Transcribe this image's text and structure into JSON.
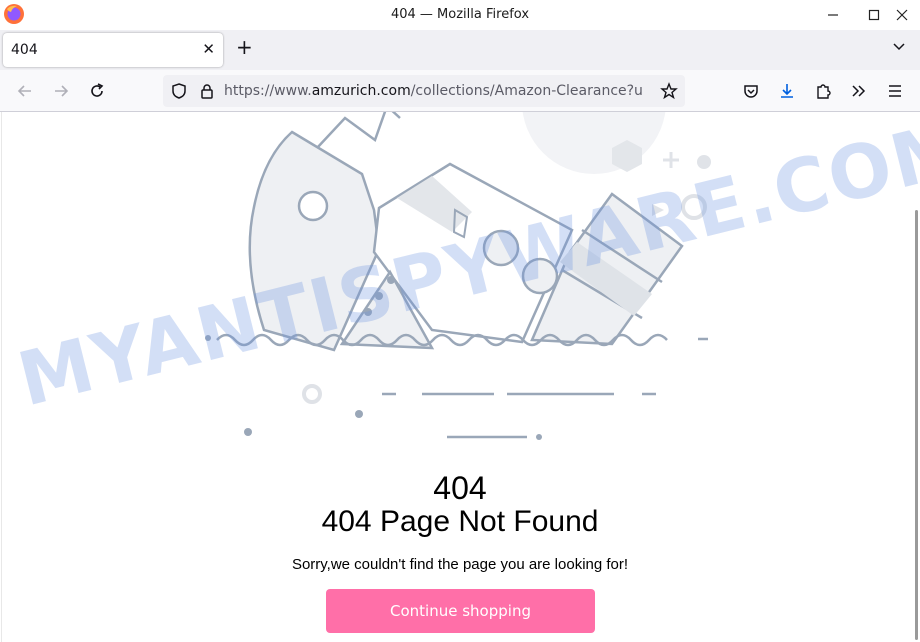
{
  "window": {
    "title": "404 — Mozilla Firefox",
    "minimize": "—",
    "maximize": "☐",
    "close": "✕"
  },
  "tabs": [
    {
      "label": "404",
      "close": "✕"
    }
  ],
  "new_tab": "+",
  "address_bar": {
    "prefix": "https://www.",
    "domain": "amzurich.com",
    "path": "/collections/Amazon-Clearance?u"
  },
  "page": {
    "code": "404",
    "title": "404 Page Not Found",
    "message": "Sorry,we couldn't find the page you are looking for!",
    "button": "Continue shopping"
  },
  "watermark": "MYANTISPYWARE.COM",
  "colors": {
    "accent_button": "#ff6fa8",
    "illustration_stroke": "#9aa7b8",
    "illustration_fill": "#eef0f3"
  }
}
